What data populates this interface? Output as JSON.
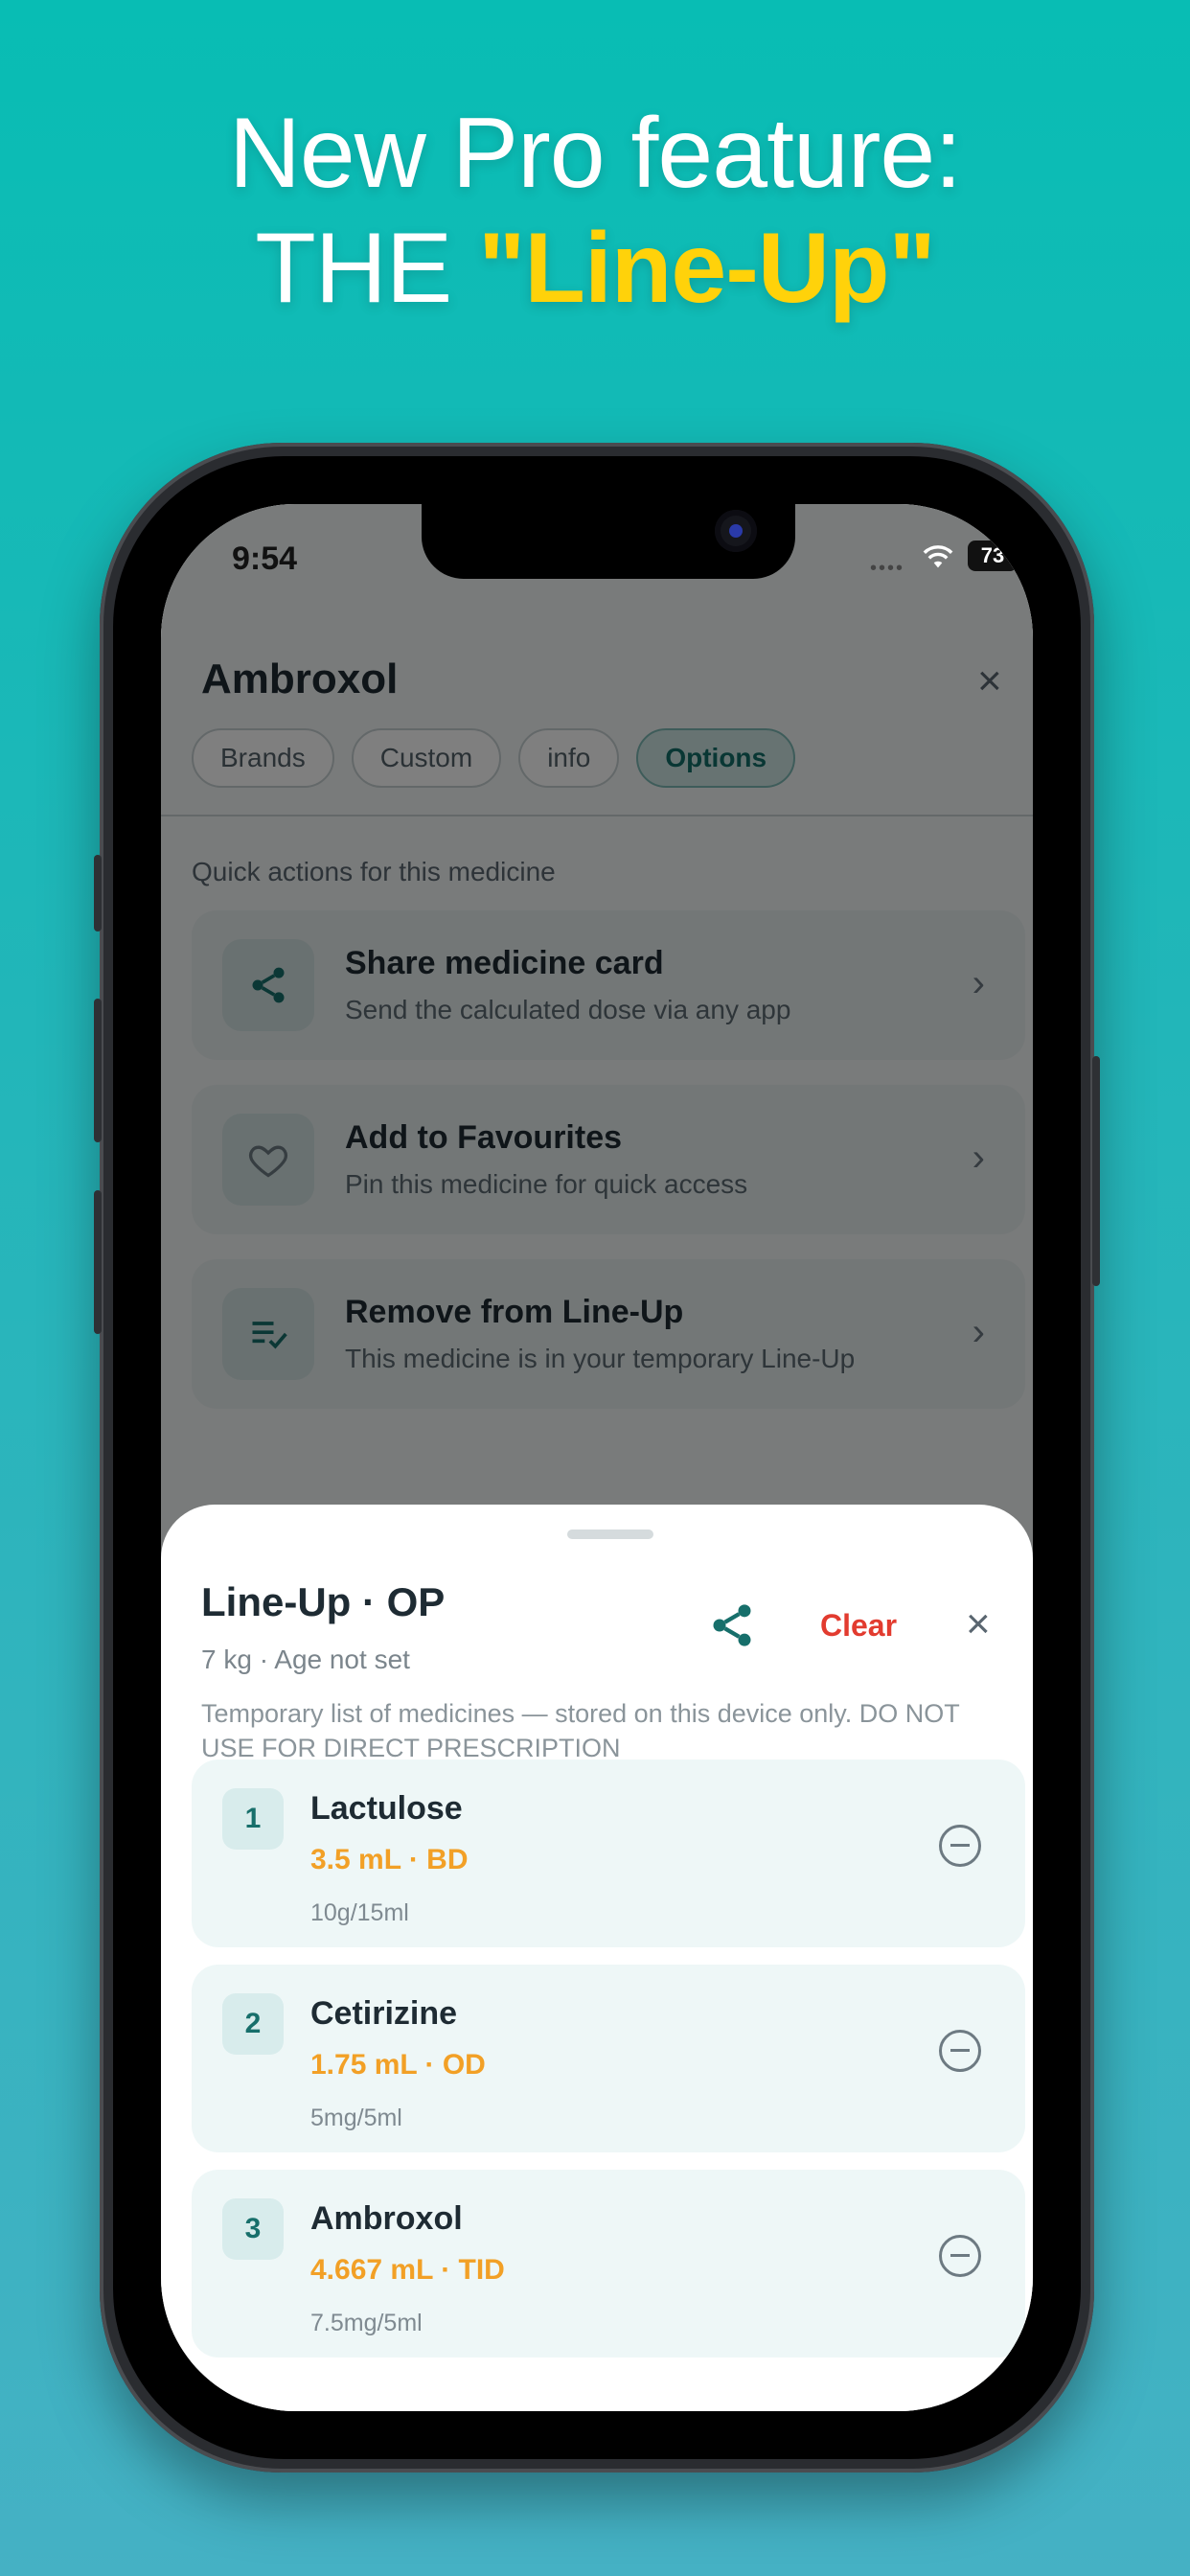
{
  "headline": {
    "line1": "New Pro feature:",
    "line2_prefix": "THE ",
    "line2_highlight": "\"Line-Up\""
  },
  "status_bar": {
    "time": "9:54",
    "signal": "••••",
    "battery": "73"
  },
  "background_page": {
    "title": "Ambroxol",
    "close_icon": "×",
    "tabs": [
      {
        "label": "Brands",
        "active": false
      },
      {
        "label": "Custom",
        "active": false
      },
      {
        "label": "info",
        "active": false
      },
      {
        "label": "Options",
        "active": true
      }
    ],
    "section_label": "Quick actions for this medicine",
    "actions": [
      {
        "title": "Share medicine card",
        "subtitle": "Send the calculated dose via any app",
        "icon": "share-icon"
      },
      {
        "title": "Add to Favourites",
        "subtitle": "Pin this medicine for quick access",
        "icon": "heart-icon"
      },
      {
        "title": "Remove from Line-Up",
        "subtitle": "This medicine is in your temporary Line-Up",
        "icon": "playlist-check-icon"
      }
    ]
  },
  "sheet": {
    "title": "Line-Up · OP",
    "subtitle": "7 kg · Age not set",
    "share_icon": "share-icon",
    "clear_label": "Clear",
    "close_icon": "×",
    "note": "Temporary list of medicines — stored on this device only. DO NOT USE FOR DIRECT PRESCRIPTION",
    "items": [
      {
        "number": "1",
        "name": "Lactulose",
        "dose": "3.5 mL · BD",
        "strength": "10g/15ml"
      },
      {
        "number": "2",
        "name": "Cetirizine",
        "dose": "1.75 mL · OD",
        "strength": "5mg/5ml"
      },
      {
        "number": "3",
        "name": "Ambroxol",
        "dose": "4.667 mL · TID",
        "strength": "7.5mg/5ml"
      }
    ]
  },
  "colors": {
    "background_top": "#08bdb4",
    "background_bottom": "#45b1c4",
    "highlight": "#ffd20a",
    "dose_orange": "#f2a026",
    "clear_red": "#e23b2f",
    "accent_teal": "#126e68"
  }
}
